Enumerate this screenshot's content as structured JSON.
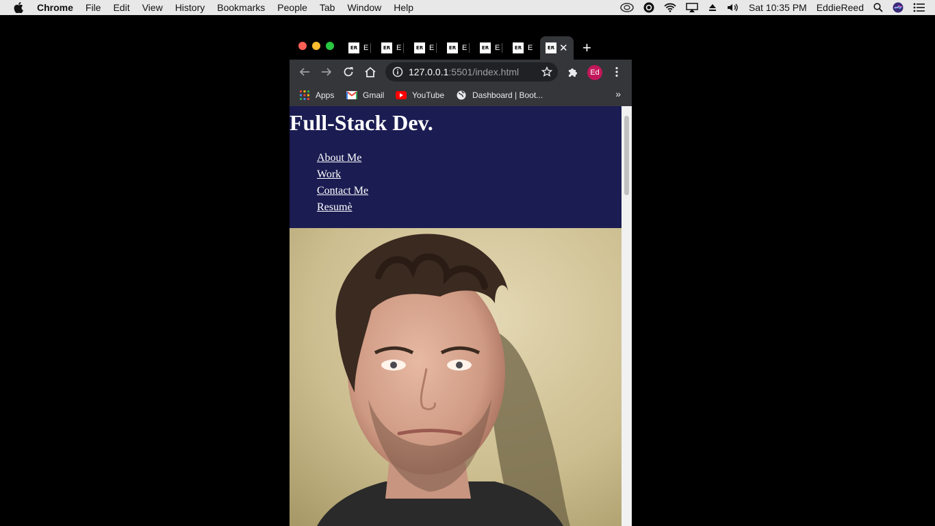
{
  "menubar": {
    "app_name": "Chrome",
    "items": [
      "File",
      "Edit",
      "View",
      "History",
      "Bookmarks",
      "People",
      "Tab",
      "Window",
      "Help"
    ],
    "clock": "Sat 10:35 PM",
    "user": "EddieReed"
  },
  "browser": {
    "tabs": [
      {
        "favicon": "ER",
        "title": "E"
      },
      {
        "favicon": "ER",
        "title": "E"
      },
      {
        "favicon": "ER",
        "title": "E"
      },
      {
        "favicon": "ER",
        "title": "E"
      },
      {
        "favicon": "ER",
        "title": "E"
      },
      {
        "favicon": "ER",
        "title": "E"
      },
      {
        "favicon": "ER",
        "title": ""
      }
    ],
    "url_host": "127.0.0.1",
    "url_rest": ":5501/index.html",
    "profile_initials": "Ed",
    "bookmarks": [
      "Apps",
      "Gmail",
      "YouTube",
      "Dashboard | Boot..."
    ],
    "bookmarks_more": "»"
  },
  "page": {
    "title": "Full-Stack Dev.",
    "nav": [
      "About Me",
      "Work",
      "Contact Me",
      "Resumè"
    ],
    "header_bg": "#1b1c52"
  }
}
